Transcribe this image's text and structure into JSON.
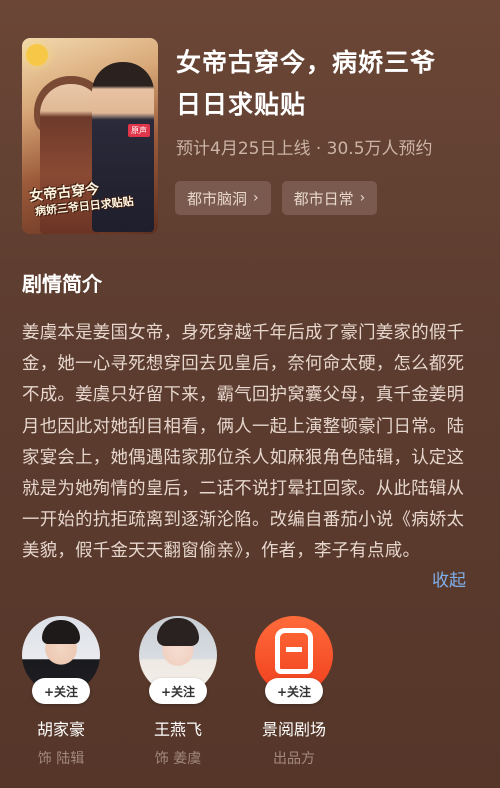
{
  "drama": {
    "title_line1": "女帝古穿今，病娇三爷",
    "title_line2": "日日求贴贴",
    "meta": "预计4月25日上线 · 30.5万人预约",
    "poster_title_1": "女帝古穿今",
    "poster_title_2": "病娇三爷日日求贴贴",
    "poster_badge": "原声"
  },
  "tags": [
    {
      "label": "都市脑洞"
    },
    {
      "label": "都市日常"
    }
  ],
  "synopsis": {
    "heading": "剧情简介",
    "text": "姜虞本是姜国女帝，身死穿越千年后成了豪门姜家的假千金，她一心寻死想穿回去见皇后，奈何命太硬，怎么都死不成。姜虞只好留下来，霸气回护窝囊父母，真千金姜明月也因此对她刮目相看，俩人一起上演整顿豪门日常。陆家宴会上，她偶遇陆家那位杀人如麻狠角色陆辑，认定这就是为她殉情的皇后，二话不说打晕扛回家。从此陆辑从一开始的抗拒疏离到逐渐沦陷。改编自番茄小说《病娇太美貌，假千金天天翻窗偷亲》，作者，李子有点咸。",
    "collapse_label": "收起"
  },
  "cast": [
    {
      "name": "胡家豪",
      "role": "饰 陆辑",
      "follow": "+关注"
    },
    {
      "name": "王燕飞",
      "role": "饰 姜虞",
      "follow": "+关注"
    },
    {
      "name": "景阅剧场",
      "role": "出品方",
      "follow": "+关注"
    }
  ],
  "icons": {
    "tag_chevron": "chevron-right-icon",
    "producer_logo": "studio-logo-icon"
  },
  "colors": {
    "link": "#7eb0ec",
    "background": "#5d3d30"
  }
}
